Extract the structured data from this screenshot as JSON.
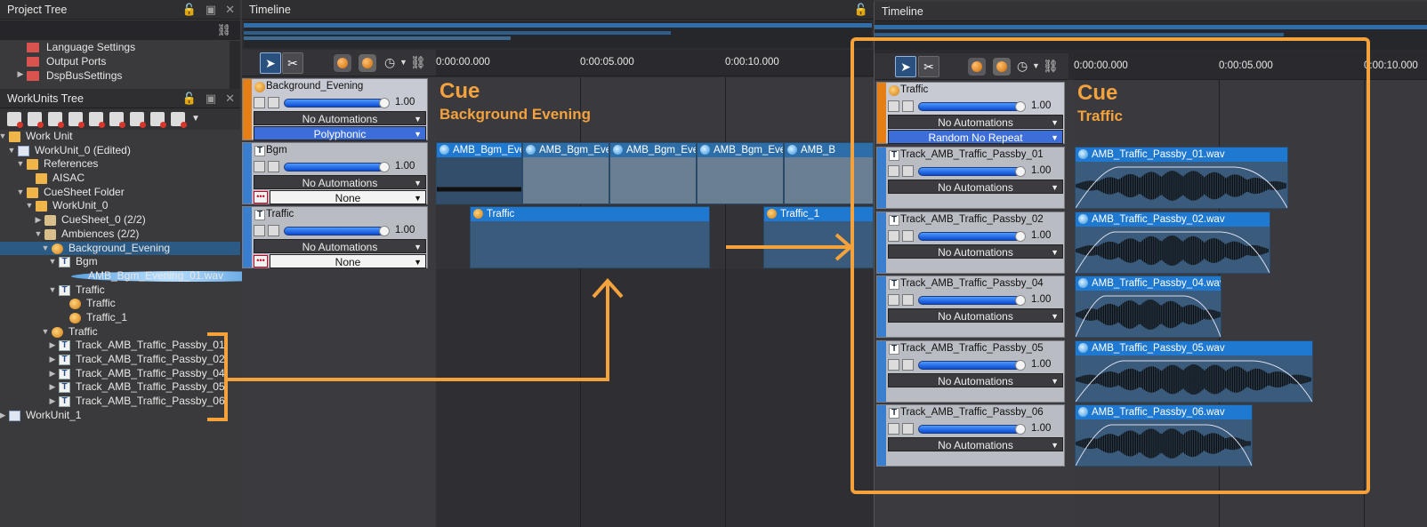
{
  "project_tree": {
    "title": "Project Tree",
    "items": [
      "Language Settings",
      "Output Ports",
      "DspBusSettings"
    ]
  },
  "workunits_tree": {
    "title": "WorkUnits Tree",
    "rows": [
      {
        "label": "Work Unit",
        "icon": "folder-icon"
      },
      {
        "label": "WorkUnit_0 (Edited)",
        "icon": "document-icon"
      },
      {
        "label": "References",
        "icon": "folder-icon"
      },
      {
        "label": "AISAC",
        "icon": "folder-icon"
      },
      {
        "label": "CueSheet Folder",
        "icon": "folder-icon"
      },
      {
        "label": "WorkUnit_0",
        "icon": "folder-icon"
      },
      {
        "label": "CueSheet_0 (2/2)",
        "icon": "cuesheet-icon"
      },
      {
        "label": "Ambiences (2/2)",
        "icon": "cuesheet-icon"
      },
      {
        "label": "Background_Evening",
        "icon": "cue-icon"
      },
      {
        "label": "Bgm",
        "icon": "track-icon"
      },
      {
        "label": "AMB_Bgm_Evening_01.wav",
        "icon": "wave-icon"
      },
      {
        "label": "Traffic",
        "icon": "track-icon"
      },
      {
        "label": "Traffic",
        "icon": "cue-icon"
      },
      {
        "label": "Traffic_1",
        "icon": "cue-icon"
      },
      {
        "label": "Traffic",
        "icon": "cue-icon"
      },
      {
        "label": "Track_AMB_Traffic_Passby_01",
        "icon": "track-icon"
      },
      {
        "label": "Track_AMB_Traffic_Passby_02",
        "icon": "track-icon"
      },
      {
        "label": "Track_AMB_Traffic_Passby_04",
        "icon": "track-icon"
      },
      {
        "label": "Track_AMB_Traffic_Passby_05",
        "icon": "track-icon"
      },
      {
        "label": "Track_AMB_Traffic_Passby_06",
        "icon": "track-icon"
      },
      {
        "label": "WorkUnit_1",
        "icon": "document-icon"
      }
    ]
  },
  "timeline_left": {
    "title": "Timeline",
    "ticks": [
      "0:00:00.000",
      "0:00:05.000",
      "0:00:10.000"
    ],
    "cue_label": "Cue",
    "cue_name": "Background Evening",
    "tracks": [
      {
        "name": "Background_Evening",
        "volume": "1.00",
        "automation": "No Automations",
        "mode": "Polyphonic"
      },
      {
        "name": "Bgm",
        "volume": "1.00",
        "automation": "No Automations",
        "mode": "None"
      },
      {
        "name": "Traffic",
        "volume": "1.00",
        "automation": "No Automations",
        "mode": "None"
      }
    ],
    "bgm_clips": [
      "AMB_Bgm_Eve",
      "AMB_Bgm_Even",
      "AMB_Bgm_Even",
      "AMB_Bgm_Even",
      "AMB_B"
    ],
    "traffic_clips": [
      "Traffic",
      "Traffic_1"
    ]
  },
  "timeline_right": {
    "title": "Timeline",
    "ticks": [
      "0:00:00.000",
      "0:00:05.000",
      "0:00:10.000"
    ],
    "cue_label": "Cue",
    "cue_name": "Traffic",
    "cue_track": {
      "name": "Traffic",
      "volume": "1.00",
      "automation": "No Automations",
      "mode": "Random No Repeat"
    },
    "tracks": [
      {
        "name": "Track_AMB_Traffic_Passby_01",
        "volume": "1.00",
        "automation": "No Automations",
        "clip": "AMB_Traffic_Passby_01.wav"
      },
      {
        "name": "Track_AMB_Traffic_Passby_02",
        "volume": "1.00",
        "automation": "No Automations",
        "clip": "AMB_Traffic_Passby_02.wav"
      },
      {
        "name": "Track_AMB_Traffic_Passby_04",
        "volume": "1.00",
        "automation": "No Automations",
        "clip": "AMB_Traffic_Passby_04.wav"
      },
      {
        "name": "Track_AMB_Traffic_Passby_05",
        "volume": "1.00",
        "automation": "No Automations",
        "clip": "AMB_Traffic_Passby_05.wav"
      },
      {
        "name": "Track_AMB_Traffic_Passby_06",
        "volume": "1.00",
        "automation": "No Automations",
        "clip": "AMB_Traffic_Passby_06.wav"
      }
    ]
  },
  "colors": {
    "accent": "#f4a23c",
    "selection": "#2b5a84",
    "clip_blue": "#1f79d0"
  }
}
